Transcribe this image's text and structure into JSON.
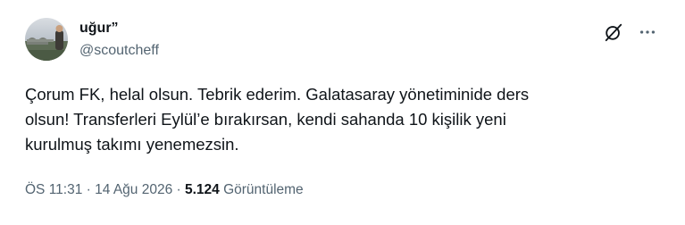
{
  "author": {
    "display_name": "uğur”",
    "handle": "@scoutcheff"
  },
  "icons": {
    "grok": "grok-icon",
    "more": "more-dots-icon"
  },
  "tweet": {
    "text": "Çorum FK, helal olsun. Tebrik ederim. Galatasaray yönetiminide ders\nolsun! Transferleri Eylül’e bırakırsan, kendi sahanda 10 kişilik yeni\nkurulmuş takımı yenemezsin."
  },
  "meta": {
    "time": "ÖS 11:31",
    "separator1": " · ",
    "date": "14 Ağu 2026",
    "separator2": " · ",
    "views_count": "5.124",
    "views_label": " Görüntüleme"
  },
  "colors": {
    "text_primary": "#0f1419",
    "text_secondary": "#536471"
  }
}
